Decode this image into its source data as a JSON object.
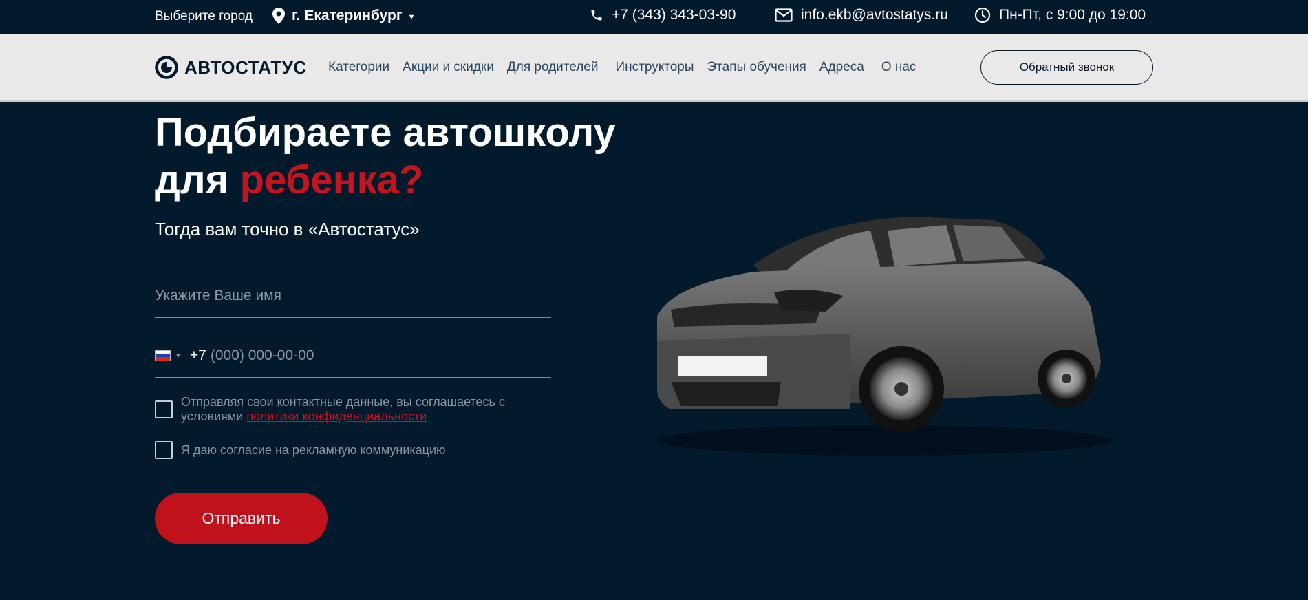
{
  "topbar": {
    "city_label": "Выберите город",
    "city_value": "г. Екатеринбург",
    "phone": "+7 (343) 343-03-90",
    "email": "info.ekb@avtostatys.ru",
    "hours": "Пн-Пт, с 9:00 до 19:00"
  },
  "nav": {
    "logo_text": "АВТОСТАТУС",
    "items": [
      "Категории",
      "Акции и скидки",
      "Для родителей",
      "Инструкторы",
      "Этапы обучения",
      "Адреса",
      "О нас"
    ],
    "callback_label": "Обратный звонок"
  },
  "hero": {
    "title_line1": "Подбираете автошколу",
    "title_line2_plain": "для",
    "title_line2_accent": "ребенка?",
    "subtitle": "Тогда вам точно в «Автостатус»"
  },
  "form": {
    "name_placeholder": "Укажите Ваше имя",
    "phone_code": "+7",
    "phone_placeholder": "(000) 000-00-00",
    "consent_text": "Отправляя свои контактные данные, вы соглашаетесь с условиями",
    "consent_link": "политики конфиденциальности",
    "ads_consent": "Я даю согласие на рекламную коммуникацию",
    "submit_label": "Отправить"
  },
  "colors": {
    "background": "#021a2c",
    "accent": "#c3151f",
    "navbar": "#e9e9e9"
  },
  "icons": [
    "pin-icon",
    "phone-icon",
    "mail-icon",
    "clock-icon",
    "logo-icon",
    "russia-flag-icon"
  ]
}
